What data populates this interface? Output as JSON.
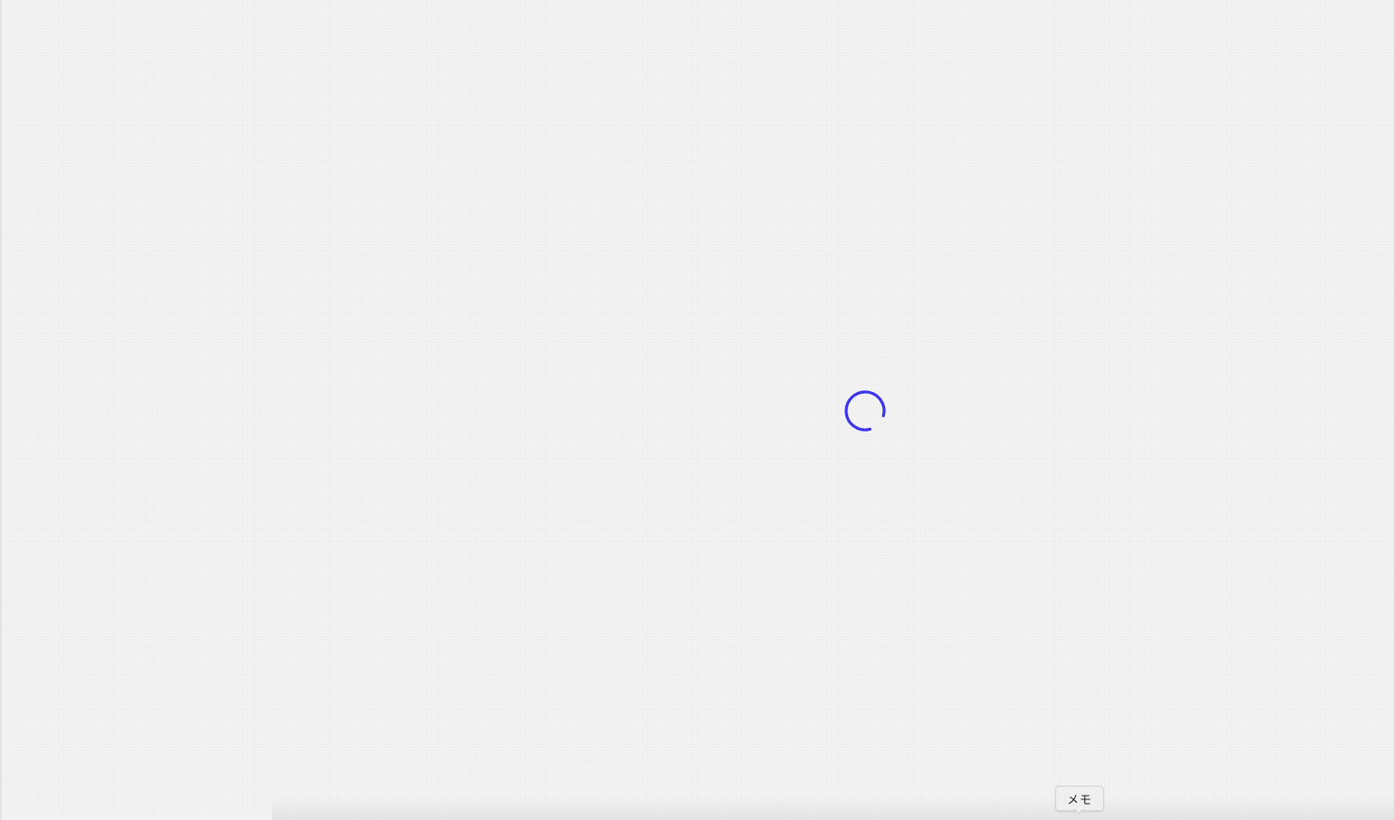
{
  "loading": {
    "spinner_icon": "loading-spinner-icon",
    "spinner_color": "#3b33e6"
  },
  "memo": {
    "label": "メモ"
  }
}
